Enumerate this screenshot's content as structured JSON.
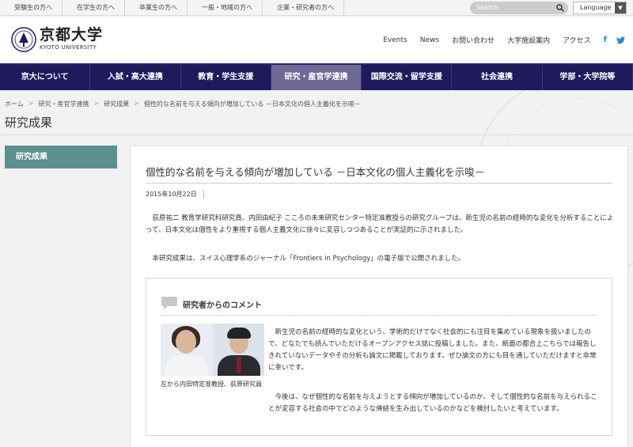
{
  "toplinks": [
    "受験生の方へ",
    "在学生の方へ",
    "卒業生の方へ",
    "一般・地域の方へ",
    "企業・研究者の方へ"
  ],
  "search": {
    "placeholder": "Search"
  },
  "language": "Language",
  "logo": {
    "ja": "京都大学",
    "en": "KYOTO UNIVERSITY"
  },
  "header_nav": [
    "Events",
    "News",
    "お問い合わせ",
    "大学施設案内",
    "アクセス"
  ],
  "social": {
    "facebook": "f",
    "twitter": "t"
  },
  "main_nav": [
    "京大について",
    "入試・高大連携",
    "教育・学生支援",
    "研究・産官学連携",
    "国際交流・留学支援",
    "社会連携",
    "学部・大学院等"
  ],
  "main_nav_active": "研究・産官学連携",
  "breadcrumb": [
    "ホーム",
    "研究・産官学連携",
    "研究成果",
    "個性的な名前を与える傾向が増加している －日本文化の個人主義化を示唆－"
  ],
  "page_title": "研究成果",
  "sidebar": {
    "active_item": "研究成果"
  },
  "article": {
    "title": "個性的な名前を与える傾向が増加している －日本文化の個人主義化を示唆－",
    "date": "2015年10月22日",
    "p1": "　荻原祐二 教育学研究科研究員、内田由紀子 こころの未来研究センター特定准教授らの研究グループは、新生児の名前の経時的な変化を分析することによって、日本文化は個性をより重視する個人主義文化に徐々に変容しつつあることが実証的に示されました。",
    "p2": "　本研究成果は、スイス心理学系のジャーナル「Frontiers in Psychology」の電子版で公開されました。"
  },
  "comment": {
    "heading": "研究者からのコメント",
    "caption": "左から内田特定准教授、荻原研究員",
    "p1": "　新生児の名前の経時的な変化という、学術的だけでなく社会的にも注目を集めている現象を扱いましたので、どなたでも読んでいただけるオープンアクセス誌に投稿しました。また、紙面の都合上こちらでは報告しきれていないデータやその分析も論文に掲載しております。ぜひ論文の方にも目を通していただけますと非常に幸いです。",
    "p2": "　今後は、なぜ個性的な名前を与えようとする傾向が増加しているのか、そして個性的な名前を与えられることが変容する社会の中でどのような帰結を生み出しているのかなどを検討したいと考えています。"
  },
  "colors": {
    "nav_bg": "#1f1a5c",
    "nav_active": "#6e6995",
    "sidebar_active": "#5d8f8f"
  }
}
